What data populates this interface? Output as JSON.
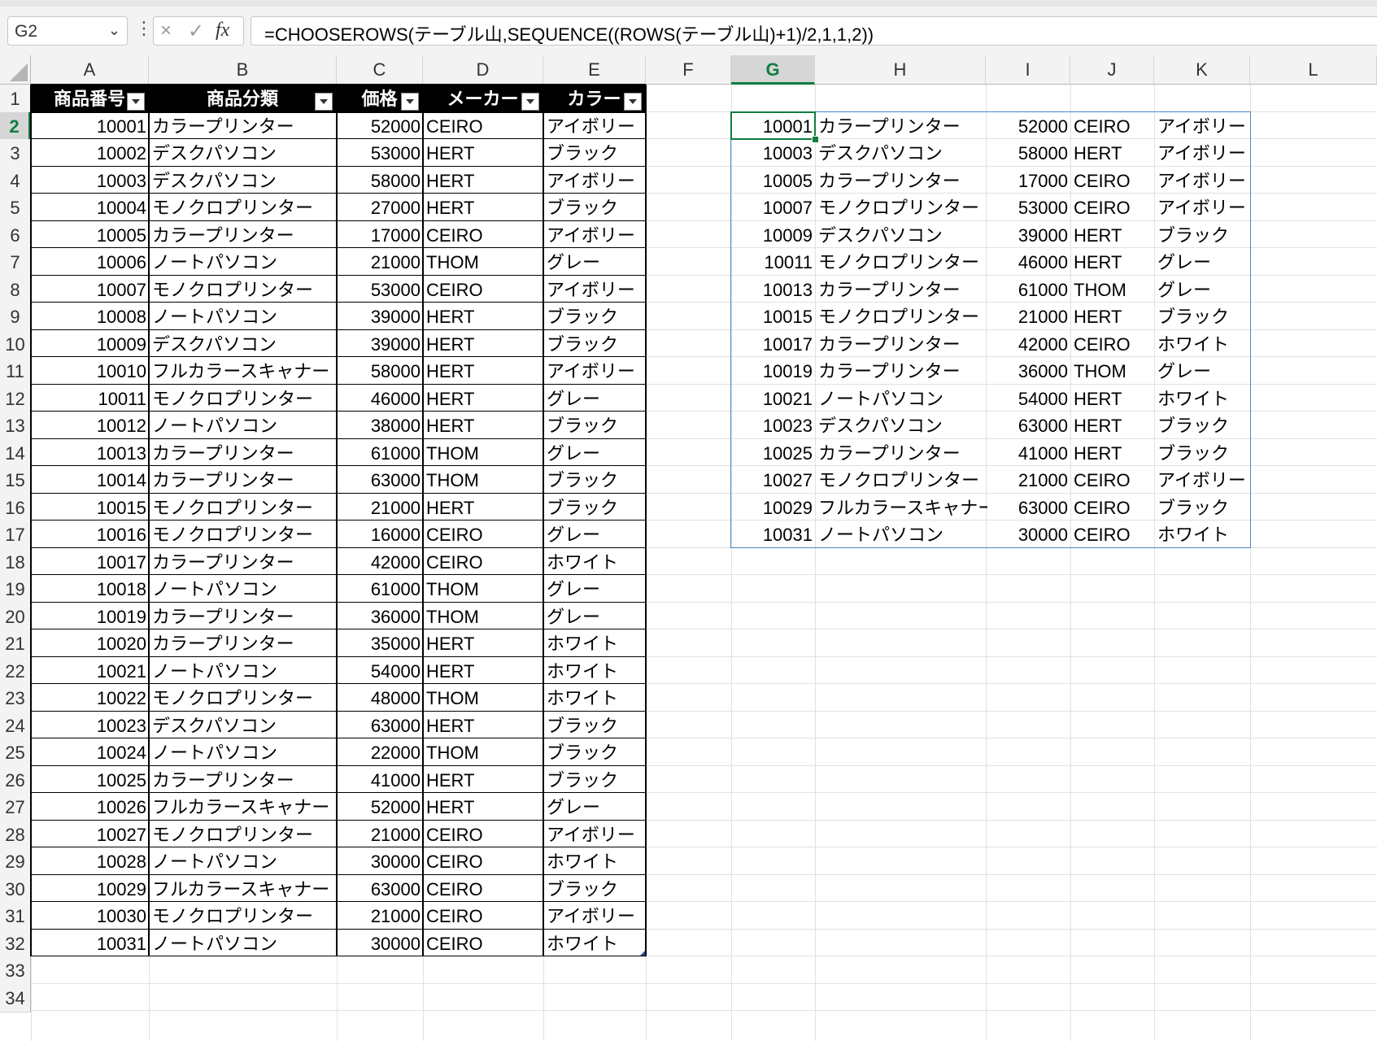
{
  "name_box": {
    "value": "G2"
  },
  "formula_bar": {
    "formula": "=CHOOSEROWS(テーブル山,SEQUENCE((ROWS(テーブル山)+1)/2,1,1,2))"
  },
  "icons": {
    "cancel": "×",
    "enter": "✓",
    "fx": "fx",
    "more": "⋮",
    "dropdown": "⌄"
  },
  "colors": {
    "selection": "#107c41",
    "spill_border": "#4a86c8",
    "table_header_bg": "#000000"
  },
  "columns": [
    "A",
    "B",
    "C",
    "D",
    "E",
    "F",
    "G",
    "H",
    "I",
    "J",
    "K",
    "L"
  ],
  "selected_column": "G",
  "selected_row": 2,
  "row_numbers": [
    1,
    2,
    3,
    4,
    5,
    6,
    7,
    8,
    9,
    10,
    11,
    12,
    13,
    14,
    15,
    16,
    17,
    18,
    19,
    20,
    21,
    22,
    23,
    24,
    25,
    26,
    27,
    28,
    29,
    30,
    31,
    32,
    33,
    34
  ],
  "table": {
    "headers": [
      "商品番号",
      "商品分類",
      "価格",
      "メーカー",
      "カラー"
    ],
    "rows": [
      [
        "10001",
        "カラープリンター",
        "52000",
        "CEIRO",
        "アイボリー"
      ],
      [
        "10002",
        "デスクパソコン",
        "53000",
        "HERT",
        "ブラック"
      ],
      [
        "10003",
        "デスクパソコン",
        "58000",
        "HERT",
        "アイボリー"
      ],
      [
        "10004",
        "モノクロプリンター",
        "27000",
        "HERT",
        "ブラック"
      ],
      [
        "10005",
        "カラープリンター",
        "17000",
        "CEIRO",
        "アイボリー"
      ],
      [
        "10006",
        "ノートパソコン",
        "21000",
        "THOM",
        "グレー"
      ],
      [
        "10007",
        "モノクロプリンター",
        "53000",
        "CEIRO",
        "アイボリー"
      ],
      [
        "10008",
        "ノートパソコン",
        "39000",
        "HERT",
        "ブラック"
      ],
      [
        "10009",
        "デスクパソコン",
        "39000",
        "HERT",
        "ブラック"
      ],
      [
        "10010",
        "フルカラースキャナー",
        "58000",
        "HERT",
        "アイボリー"
      ],
      [
        "10011",
        "モノクロプリンター",
        "46000",
        "HERT",
        "グレー"
      ],
      [
        "10012",
        "ノートパソコン",
        "38000",
        "HERT",
        "ブラック"
      ],
      [
        "10013",
        "カラープリンター",
        "61000",
        "THOM",
        "グレー"
      ],
      [
        "10014",
        "カラープリンター",
        "63000",
        "THOM",
        "ブラック"
      ],
      [
        "10015",
        "モノクロプリンター",
        "21000",
        "HERT",
        "ブラック"
      ],
      [
        "10016",
        "モノクロプリンター",
        "16000",
        "CEIRO",
        "グレー"
      ],
      [
        "10017",
        "カラープリンター",
        "42000",
        "CEIRO",
        "ホワイト"
      ],
      [
        "10018",
        "ノートパソコン",
        "61000",
        "THOM",
        "グレー"
      ],
      [
        "10019",
        "カラープリンター",
        "36000",
        "THOM",
        "グレー"
      ],
      [
        "10020",
        "カラープリンター",
        "35000",
        "HERT",
        "ホワイト"
      ],
      [
        "10021",
        "ノートパソコン",
        "54000",
        "HERT",
        "ホワイト"
      ],
      [
        "10022",
        "モノクロプリンター",
        "48000",
        "THOM",
        "ホワイト"
      ],
      [
        "10023",
        "デスクパソコン",
        "63000",
        "HERT",
        "ブラック"
      ],
      [
        "10024",
        "ノートパソコン",
        "22000",
        "THOM",
        "ブラック"
      ],
      [
        "10025",
        "カラープリンター",
        "41000",
        "HERT",
        "ブラック"
      ],
      [
        "10026",
        "フルカラースキャナー",
        "52000",
        "HERT",
        "グレー"
      ],
      [
        "10027",
        "モノクロプリンター",
        "21000",
        "CEIRO",
        "アイボリー"
      ],
      [
        "10028",
        "ノートパソコン",
        "30000",
        "CEIRO",
        "ホワイト"
      ],
      [
        "10029",
        "フルカラースキャナー",
        "63000",
        "CEIRO",
        "ブラック"
      ],
      [
        "10030",
        "モノクロプリンター",
        "21000",
        "CEIRO",
        "アイボリー"
      ],
      [
        "10031",
        "ノートパソコン",
        "30000",
        "CEIRO",
        "ホワイト"
      ]
    ]
  },
  "spill": {
    "rows": [
      [
        "10001",
        "カラープリンター",
        "52000",
        "CEIRO",
        "アイボリー"
      ],
      [
        "10003",
        "デスクパソコン",
        "58000",
        "HERT",
        "アイボリー"
      ],
      [
        "10005",
        "カラープリンター",
        "17000",
        "CEIRO",
        "アイボリー"
      ],
      [
        "10007",
        "モノクロプリンター",
        "53000",
        "CEIRO",
        "アイボリー"
      ],
      [
        "10009",
        "デスクパソコン",
        "39000",
        "HERT",
        "ブラック"
      ],
      [
        "10011",
        "モノクロプリンター",
        "46000",
        "HERT",
        "グレー"
      ],
      [
        "10013",
        "カラープリンター",
        "61000",
        "THOM",
        "グレー"
      ],
      [
        "10015",
        "モノクロプリンター",
        "21000",
        "HERT",
        "ブラック"
      ],
      [
        "10017",
        "カラープリンター",
        "42000",
        "CEIRO",
        "ホワイト"
      ],
      [
        "10019",
        "カラープリンター",
        "36000",
        "THOM",
        "グレー"
      ],
      [
        "10021",
        "ノートパソコン",
        "54000",
        "HERT",
        "ホワイト"
      ],
      [
        "10023",
        "デスクパソコン",
        "63000",
        "HERT",
        "ブラック"
      ],
      [
        "10025",
        "カラープリンター",
        "41000",
        "HERT",
        "ブラック"
      ],
      [
        "10027",
        "モノクロプリンター",
        "21000",
        "CEIRO",
        "アイボリー"
      ],
      [
        "10029",
        "フルカラースキャナー",
        "63000",
        "CEIRO",
        "ブラック"
      ],
      [
        "10031",
        "ノートパソコン",
        "30000",
        "CEIRO",
        "ホワイト"
      ]
    ]
  }
}
